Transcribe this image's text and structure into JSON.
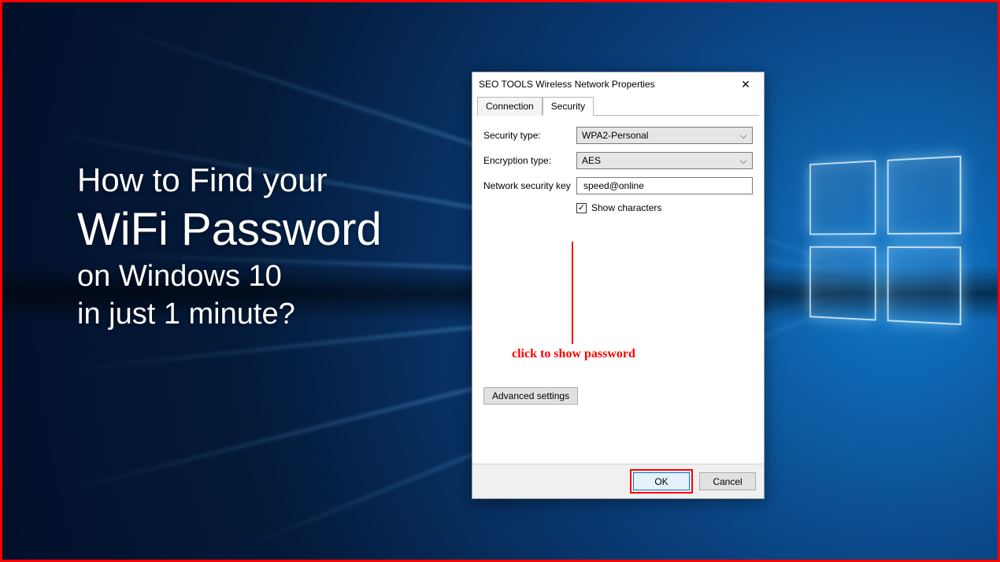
{
  "headline": {
    "line1": "How to Find your",
    "line2": "WiFi Password",
    "line3": "on Windows 10",
    "line4": "in just 1 minute?"
  },
  "dialog": {
    "title": "SEO TOOLS Wireless Network Properties",
    "tabs": {
      "connection": "Connection",
      "security": "Security"
    },
    "labels": {
      "security_type": "Security type:",
      "encryption_type": "Encryption type:",
      "network_key": "Network security key",
      "show_characters": "Show characters",
      "advanced": "Advanced settings"
    },
    "values": {
      "security_type": "WPA2-Personal",
      "encryption_type": "AES",
      "network_key": "speed@online",
      "show_checked": "✓"
    },
    "buttons": {
      "ok": "OK",
      "cancel": "Cancel"
    }
  },
  "annotation": {
    "text": "click to show password"
  }
}
